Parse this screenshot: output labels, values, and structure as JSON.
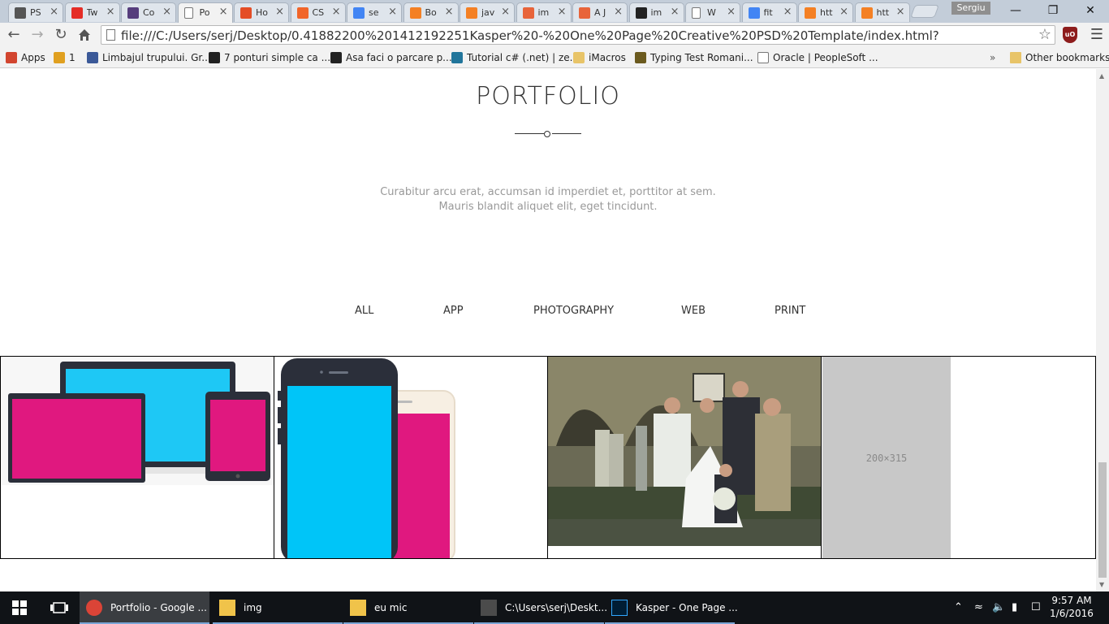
{
  "browser": {
    "tabs": [
      {
        "label": "PS",
        "icon": "T",
        "color": "#555555"
      },
      {
        "label": "Tw",
        "icon": "yt",
        "color": "#e52d27"
      },
      {
        "label": "Co",
        "icon": "B",
        "color": "#563d7c"
      },
      {
        "label": "Po",
        "icon": "page",
        "color": "#ffffff",
        "active": true
      },
      {
        "label": "Ho",
        "icon": "</>",
        "color": "#e44d26"
      },
      {
        "label": "CS",
        "icon": "+",
        "color": "#f16529"
      },
      {
        "label": "se",
        "icon": "G",
        "color": "#4285f4"
      },
      {
        "label": "Bo",
        "icon": "so",
        "color": "#f48024"
      },
      {
        "label": "jav",
        "icon": "so",
        "color": "#f48024"
      },
      {
        "label": "im",
        "icon": "X",
        "color": "#e8643a"
      },
      {
        "label": "A J",
        "icon": "X",
        "color": "#e8643a"
      },
      {
        "label": "im",
        "icon": "gh",
        "color": "#222222"
      },
      {
        "label": "W",
        "icon": "page",
        "color": "#ffffff"
      },
      {
        "label": "fit",
        "icon": "G",
        "color": "#4285f4"
      },
      {
        "label": "htt",
        "icon": "so",
        "color": "#f48024"
      },
      {
        "label": "htt",
        "icon": "so",
        "color": "#f48024"
      }
    ],
    "close_glyph": "×",
    "profile_name": "Sergiu",
    "window_controls": {
      "minimize": "—",
      "restore": "❐",
      "close": "✕"
    },
    "url": "file:///C:/Users/serj/Desktop/0.41882200%201412192251Kasper%20-%20One%20Page%20Creative%20PSD%20Template/index.html?",
    "extension_label": "uO",
    "bookmarks": [
      {
        "label": "Apps",
        "icon": "apps-icon"
      },
      {
        "label": "1",
        "icon": "pinwheel-icon"
      },
      {
        "label": "Limbajul trupului. Gr...",
        "icon": "site-icon"
      },
      {
        "label": "7 ponturi simple ca ...",
        "icon": "info-icon"
      },
      {
        "label": "Asa faci o parcare p...",
        "icon": "info-icon"
      },
      {
        "label": "Tutorial c# (.net) | ze...",
        "icon": "wp-icon"
      },
      {
        "label": "iMacros",
        "icon": "folder-icon"
      },
      {
        "label": "Typing Test Romani...",
        "icon": "trophy-icon"
      },
      {
        "label": "Oracle | PeopleSoft ...",
        "icon": "page-icon"
      }
    ],
    "bookmarks_overflow": "»",
    "other_bookmarks": "Other bookmarks"
  },
  "page": {
    "title": "PORTFOLIO",
    "description_line1": "Curabitur arcu erat, accumsan id imperdiet et, porttitor at sem.",
    "description_line2": "Mauris blandit aliquet elit, eget tincidunt.",
    "filters": [
      "ALL",
      "APP",
      "PHOTOGRAPHY",
      "WEB",
      "PRINT"
    ],
    "gallery": [
      {
        "kind": "devices-illustration"
      },
      {
        "kind": "phones-illustration"
      },
      {
        "kind": "wedding-photo"
      },
      {
        "kind": "placeholder",
        "label": "200×315"
      }
    ],
    "colors": {
      "screen_blue": "#1ec8f5",
      "screen_pink": "#e0187f",
      "device_dark": "#2b2f3a"
    }
  },
  "taskbar": {
    "apps": [
      {
        "label": "Portfolio - Google ...",
        "icon": "chrome-icon",
        "active": true
      },
      {
        "label": "img",
        "icon": "folder-icon"
      },
      {
        "label": "eu mic",
        "icon": "folder-icon"
      },
      {
        "label": "C:\\Users\\serj\\Deskt...",
        "icon": "sublime-icon"
      },
      {
        "label": "Kasper - One Page ...",
        "icon": "photoshop-icon"
      }
    ],
    "time": "9:57 AM",
    "date": "1/6/2016"
  }
}
